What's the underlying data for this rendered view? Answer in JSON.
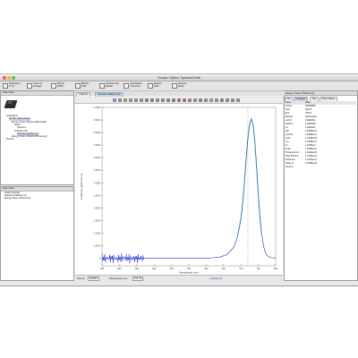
{
  "window": {
    "title": "Ocean Optics SpectraSuite",
    "traffic_colors": [
      "#ee5b4f",
      "#f5b43a",
      "#5fc23f"
    ]
  },
  "toolbar": {
    "items": [
      {
        "label": "Integration Time",
        "icon": "integration-clock-icon"
      },
      {
        "label": "Scans to Average",
        "icon": "scans-average-icon"
      },
      {
        "label": "Boxcar Width",
        "icon": "boxcar-width-icon"
      },
      {
        "label": "Electric Dark",
        "icon": "electric-dark-icon"
      },
      {
        "label": "Strobe/Lamp Enable",
        "icon": "lamp-enable-icon"
      },
      {
        "label": "Nonlinearity Correction",
        "icon": "nonlinearity-icon"
      },
      {
        "label": "Electric Dark",
        "icon": "dark-toggle-icon"
      },
      {
        "label": "Reverse Mode",
        "icon": "reverse-mode-icon"
      }
    ]
  },
  "toolbar2": {
    "wavelength_label": "Wavelength",
    "strobe_label": "Strobe Light",
    "external_trigger_label": "External Trigger",
    "mode_value": "Normal",
    "buttons": [
      "▶",
      "■",
      "●"
    ]
  },
  "acquisitions_panel": {
    "title": "Data Views",
    "tree": [
      {
        "label": "Acquisitions",
        "indent": 0,
        "highlight": false
      },
      {
        "label": "SF-002 / Spectrometer",
        "indent": 1,
        "highlight": true
      },
      {
        "label": "Energy, Power, Photons (Microwatts)",
        "indent": 2,
        "highlight": false
      },
      {
        "label": "Result",
        "indent": 3,
        "highlight": false
      },
      {
        "label": "Spectrum",
        "indent": 4,
        "highlight": false
      },
      {
        "label": "Irradiance Ref",
        "indent": 3,
        "highlight": false
      },
      {
        "label": "Absolute Irradiance (A)",
        "indent": 4,
        "highlight": true
      },
      {
        "label": "Energy, Power, Photons (Processing)",
        "indent": 2,
        "highlight": false
      },
      {
        "label": "Projects",
        "indent": 0,
        "highlight": false
      }
    ]
  },
  "dataviews_panel": {
    "title": "Data Views",
    "items": [
      "Graph (Overlay)",
      "Absolute Irradiance (A)",
      "Energy, Power, Photons (A)"
    ]
  },
  "graph": {
    "tabs": [
      "Graph(A)",
      "Absolute Irradiance (A)"
    ],
    "ylabel": "Irradiance (µW/cm²/nm)",
    "xlabel": "Wavelength (nm)",
    "y_ticks": [
      "0",
      "0.5000",
      "1.0000",
      "1.5000",
      "2.0000",
      "2.5000",
      "3.0000",
      "3.5000",
      "4.0000",
      "4.5000",
      "5.0000",
      "5.5000",
      "6.0000"
    ],
    "x_ticks": [
      "300",
      "350",
      "400",
      "450",
      "500",
      "550",
      "600",
      "650",
      "700",
      "750",
      "800"
    ],
    "status": {
      "source_label": "Source",
      "source_value": "FRR58",
      "wavelength_label": "Wavelength (nm)",
      "wavelength_value": "251.91",
      "value_label": "1.4802E-01"
    },
    "colors": {
      "series": "#1a2bd0",
      "peak_overlay": "#3aa876",
      "cursor": "#777777"
    }
  },
  "chart_data": {
    "type": "line",
    "xlabel": "Wavelength (nm)",
    "ylabel": "Irradiance (µW/cm²/nm)",
    "xlim": [
      300,
      800
    ],
    "ylim": [
      -0.3,
      6.0
    ],
    "series": [
      {
        "x": [
          300,
          320,
          340,
          360,
          380,
          400,
          420,
          440,
          460,
          480,
          500,
          520,
          540,
          560,
          580,
          600,
          620,
          640,
          660,
          680,
          690,
          700,
          705,
          710,
          715,
          720,
          725,
          730,
          735,
          740,
          745,
          750,
          755,
          760,
          765,
          770,
          775,
          780,
          790,
          800
        ],
        "values": [
          -0.05,
          0.02,
          -0.04,
          0.03,
          -0.02,
          0.01,
          -0.01,
          0.0,
          0.0,
          0.0,
          0.0,
          0.0,
          0.0,
          0.0,
          0.0,
          0.0,
          0.02,
          0.05,
          0.15,
          0.45,
          0.85,
          1.55,
          2.15,
          2.95,
          3.9,
          4.75,
          5.3,
          5.55,
          5.35,
          4.7,
          3.7,
          2.6,
          1.65,
          0.95,
          0.5,
          0.25,
          0.12,
          0.06,
          0.02,
          0.01
        ]
      }
    ]
  },
  "results_panel": {
    "title": "Energy, Power, Photons (A)",
    "tabs": [
      "File",
      "Configure",
      "Tray",
      "Paste Values"
    ],
    "rows": [
      {
        "k": "Name",
        "v": "Value"
      },
      {
        "k": "Source",
        "v": "FRR58855"
      },
      {
        "k": "Start",
        "v": "300.00"
      },
      {
        "k": "End",
        "v": "795.57"
      },
      {
        "k": "Method",
        "v": "Rectangular"
      },
      {
        "k": "µJ/cm²",
        "v": "4.82E0011"
      },
      {
        "k": "µW/cm²",
        "v": "4.21E0005"
      },
      {
        "k": "µJ",
        "v": "4.16E0011"
      },
      {
        "k": "µW",
        "v": "1.2280E+01"
      },
      {
        "k": "µmol/m²",
        "v": "3.2490E+01"
      },
      {
        "k": "µmol",
        "v": "1.2100E+00"
      },
      {
        "k": "Lux",
        "v": "4.2180E+01"
      },
      {
        "k": "lm",
        "v": "1.1230E+0"
      },
      {
        "k": "Peak",
        "v": "4.2285E+01"
      },
      {
        "k": "Photons/cm²/s",
        "v": "1.6121E+03"
      },
      {
        "k": "Total Photons",
        "v": "2.7220E+04"
      },
      {
        "k": "Photons/s",
        "v": "1.2117E+14"
      },
      {
        "k": "Moles of photons",
        "v": "4.4518E+00"
      }
    ]
  }
}
